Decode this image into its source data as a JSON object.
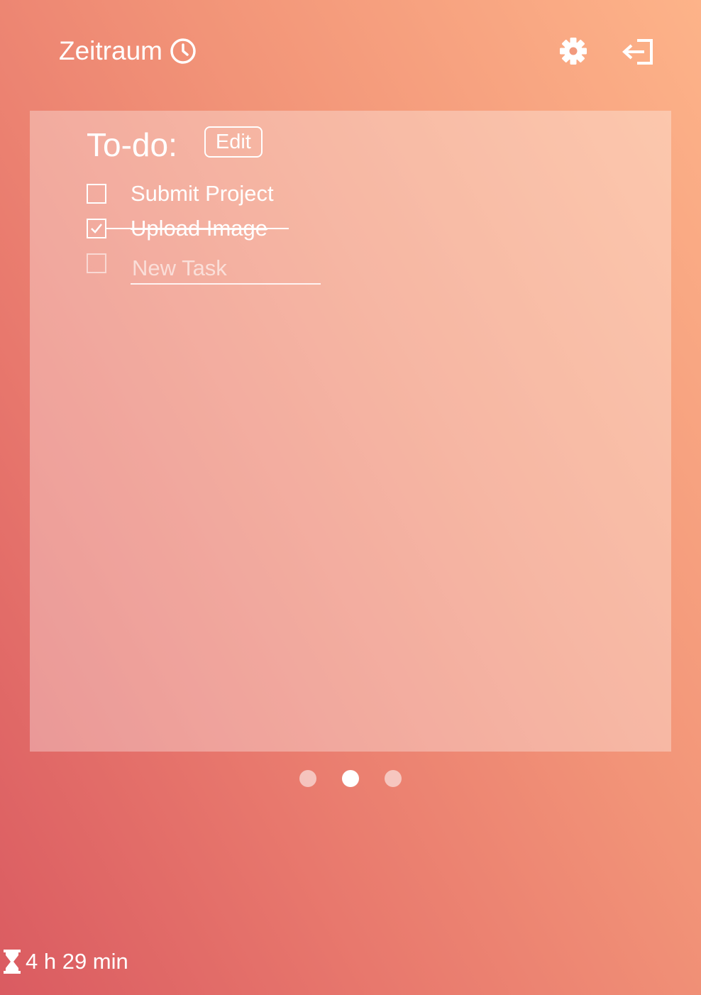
{
  "header": {
    "app_title": "Zeitraum",
    "clock_icon": "clock-icon",
    "settings_icon": "gear-icon",
    "logout_icon": "logout-icon"
  },
  "todo": {
    "heading": "To-do:",
    "edit_label": "Edit",
    "tasks": [
      {
        "label": "Submit Project",
        "checked": false
      },
      {
        "label": "Upload Image",
        "checked": true
      }
    ],
    "new_task_placeholder": "New Task",
    "new_task_value": ""
  },
  "pager": {
    "page_count": 3,
    "active_page": 2
  },
  "timer": {
    "icon": "hourglass-icon",
    "text": "4 h 29 min"
  },
  "colors": {
    "background_gradient": [
      "#da5b61",
      "#e8786d",
      "#f29478",
      "#fdb389"
    ],
    "foreground": "#ffffff"
  }
}
